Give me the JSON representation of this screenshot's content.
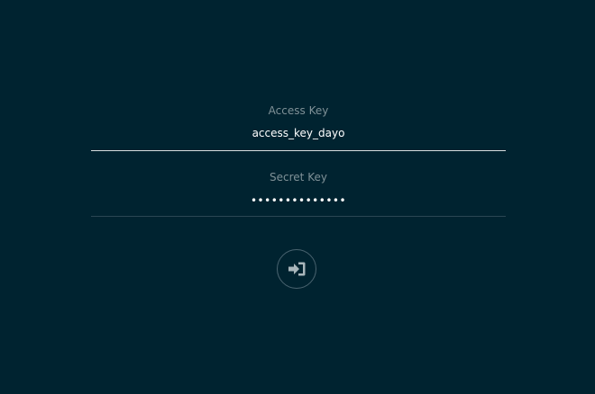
{
  "login": {
    "access_key": {
      "label": "Access Key",
      "value": "access_key_dayo"
    },
    "secret_key": {
      "label": "Secret Key",
      "value": "••••••••••••••"
    },
    "submit": {
      "icon": "sign-in-icon",
      "icon_color": "#a9b6bb"
    }
  },
  "colors": {
    "background": "#002330",
    "label": "#7f9197",
    "text": "#ffffff",
    "active_underline": "#d9dee0",
    "inactive_underline": "#2a4754"
  }
}
